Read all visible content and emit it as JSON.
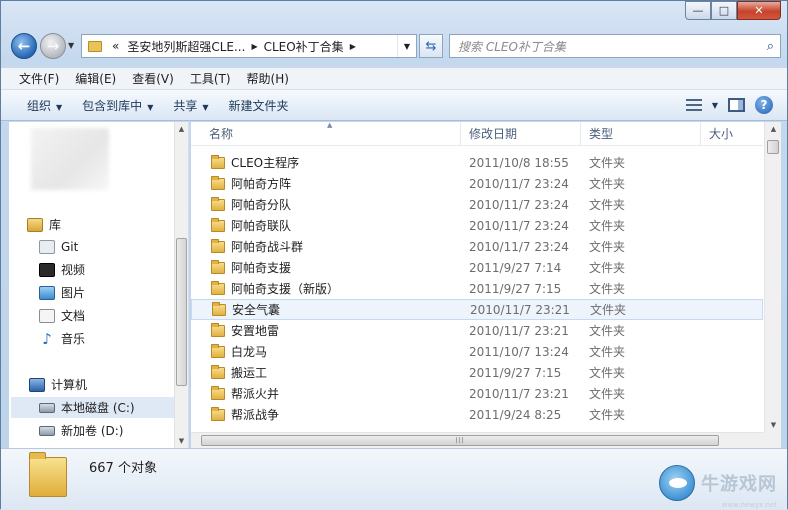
{
  "window": {
    "caption_minimize": "—",
    "caption_maximize": "□",
    "caption_close": "✕"
  },
  "address": {
    "overflow": "«",
    "seg1": "圣安地列斯超强CLE...",
    "seg2": "CLEO补丁合集",
    "search_placeholder": "搜索 CLEO补丁合集"
  },
  "menu": [
    "文件(F)",
    "编辑(E)",
    "查看(V)",
    "工具(T)",
    "帮助(H)"
  ],
  "toolbar": {
    "organize": "组织",
    "include_library": "包含到库中",
    "share": "共享",
    "new_folder": "新建文件夹"
  },
  "nav": {
    "library": "库",
    "git": "Git",
    "video": "视频",
    "pictures": "图片",
    "documents": "文档",
    "music": "音乐",
    "computer": "计算机",
    "local_disk": "本地磁盘 (C:)",
    "new_volume": "新加卷 (D:)"
  },
  "columns": {
    "name": "名称",
    "date": "修改日期",
    "type": "类型",
    "size": "大小"
  },
  "files": [
    {
      "name": "CLEO主程序",
      "date": "2011/10/8 18:55",
      "type": "文件夹"
    },
    {
      "name": "阿帕奇方阵",
      "date": "2010/11/7 23:24",
      "type": "文件夹"
    },
    {
      "name": "阿帕奇分队",
      "date": "2010/11/7 23:24",
      "type": "文件夹"
    },
    {
      "name": "阿帕奇联队",
      "date": "2010/11/7 23:24",
      "type": "文件夹"
    },
    {
      "name": "阿帕奇战斗群",
      "date": "2010/11/7 23:24",
      "type": "文件夹"
    },
    {
      "name": "阿帕奇支援",
      "date": "2011/9/27 7:14",
      "type": "文件夹"
    },
    {
      "name": "阿帕奇支援（新版）",
      "date": "2011/9/27 7:15",
      "type": "文件夹"
    },
    {
      "name": "安全气囊",
      "date": "2010/11/7 23:21",
      "type": "文件夹"
    },
    {
      "name": "安置地雷",
      "date": "2010/11/7 23:21",
      "type": "文件夹"
    },
    {
      "name": "白龙马",
      "date": "2011/10/7 13:24",
      "type": "文件夹"
    },
    {
      "name": "搬运工",
      "date": "2011/9/27 7:15",
      "type": "文件夹"
    },
    {
      "name": "帮派火并",
      "date": "2010/11/7 23:21",
      "type": "文件夹"
    },
    {
      "name": "帮派战争",
      "date": "2011/9/24 8:25",
      "type": "文件夹"
    }
  ],
  "status": {
    "count": "667 个对象"
  },
  "watermark": {
    "text": "牛游戏网",
    "url": "www.newyx.net"
  }
}
